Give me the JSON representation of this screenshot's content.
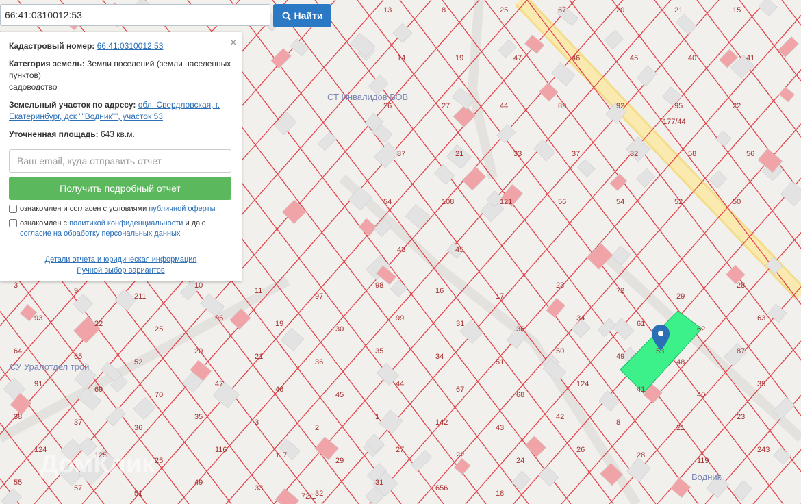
{
  "search": {
    "value": "66:41:0310012:53",
    "button_label": "Найти"
  },
  "panel": {
    "close_glyph": "×",
    "cadastral_label": "Кадастровый номер:",
    "cadastral_value": "66:41:0310012:53",
    "category_label": "Категория земель:",
    "category_value": "Земли поселений (земли населенных пунктов)",
    "usage": "садоводство",
    "address_label": "Земельный участок по адресу:",
    "address_value": "обл. Свердловская, г. Екатеринбург, дск \"\"Водник\"\", участок 53",
    "area_label": "Уточненная площадь:",
    "area_value": "643 кв.м.",
    "email_placeholder": "Ваш email, куда отправить отчет",
    "get_report": "Получить подробный отчет",
    "agree1_text": "ознакомлен и согласен с условиями",
    "agree1_link": "публичной оферты",
    "agree2_text1": "ознакомлен с",
    "agree2_link1": "политикой конфиденциальности",
    "agree2_text2": "и даю",
    "agree2_link2": "согласие на обработку персональных данных",
    "details_link": "Детали отчета и юридическая информация",
    "manual_link": "Ручной выбор вариантов"
  },
  "map": {
    "area_labels": [
      "СТ Инвалидов ВОВ",
      "СУ Уралотдел трой",
      "Водник"
    ],
    "watermark": "ДомКлик",
    "parcels_ne": [
      "13",
      "8",
      "25",
      "67",
      "20",
      "21",
      "15",
      "14",
      "19",
      "47",
      "46",
      "45",
      "40",
      "41",
      "26",
      "27",
      "44",
      "89",
      "92",
      "95",
      "22",
      "87",
      "21",
      "33",
      "37",
      "32",
      "58",
      "56",
      "54",
      "108",
      "121",
      "56",
      "54",
      "52",
      "50",
      "43",
      "45"
    ],
    "parcels_sw": [
      "3",
      "9",
      "211",
      "10",
      "11",
      "97",
      "98",
      "16",
      "17",
      "23",
      "72",
      "29",
      "28",
      "93",
      "22",
      "25",
      "96",
      "19",
      "30",
      "99",
      "31",
      "36",
      "34",
      "61",
      "62",
      "63",
      "64",
      "65",
      "52",
      "20",
      "21",
      "36",
      "35",
      "34",
      "51",
      "50",
      "49",
      "48",
      "87",
      "91",
      "69",
      "70",
      "47",
      "46",
      "45",
      "44",
      "67",
      "68",
      "124",
      "41",
      "40",
      "39",
      "38",
      "37",
      "36",
      "35",
      "3",
      "2",
      "1",
      "142",
      "43",
      "42",
      "8",
      "21",
      "23",
      "124",
      "125",
      "25",
      "116",
      "117",
      "29",
      "27",
      "22",
      "24",
      "26",
      "28",
      "119",
      "243",
      "55",
      "57",
      "51",
      "49",
      "33",
      "32",
      "31",
      "656",
      "18"
    ],
    "highlight_parcel": "53",
    "street_labels": [
      "177/44",
      "72/1"
    ]
  },
  "colors": {
    "parcel_line": "#e0424a",
    "highlight": "#3cf08a",
    "building": "#e3e3e3",
    "building_red": "#f1a4a7",
    "road": "#f9e39a",
    "accent": "#2b78c5",
    "green_btn": "#5cb85c"
  }
}
